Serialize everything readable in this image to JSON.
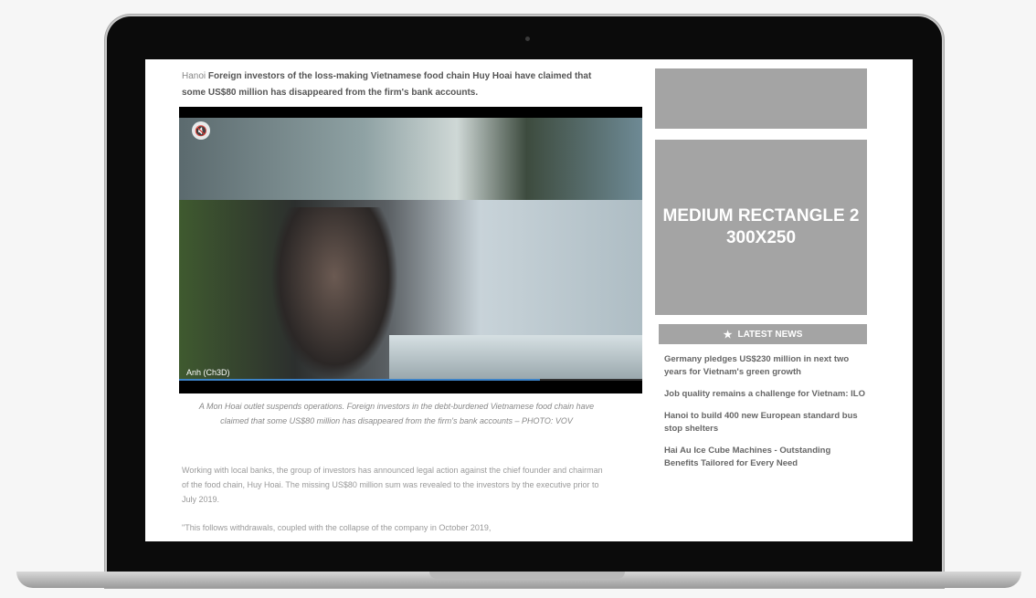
{
  "article": {
    "dateline": "Hanoi",
    "intro": "Foreign investors of the loss-making Vietnamese food chain Huy Hoai have claimed that some US$80 million has disappeared from the firm's bank accounts.",
    "video_credit": "Anh (Ch3D)",
    "video_progress_percent": 78,
    "caption": "A Mon Hoai outlet suspends operations. Foreign investors in the debt-burdened Vietnamese food chain have claimed that some US$80 million has disappeared from the firm's bank accounts – PHOTO: VOV",
    "paragraphs": [
      "Working with local banks, the group of investors has announced legal action against the chief founder and chairman of the food chain, Huy Hoai. The missing US$80 million sum was revealed to the investors by the executive prior to July 2019.",
      "\"This follows withdrawals, coupled with the collapse of the company in October 2019,"
    ]
  },
  "sidebar": {
    "ad_label_line1": "MEDIUM RECTANGLE 2",
    "ad_label_line2": "300X250",
    "latest_news_title": "LATEST NEWS",
    "news": [
      "Germany pledges US$230 million in next two years for Vietnam's green growth",
      "Job quality remains a challenge for Vietnam: ILO",
      "Hanoi to build 400 new European standard bus stop shelters",
      "Hai Au Ice Cube Machines - Outstanding Benefits Tailored for Every Need"
    ]
  }
}
